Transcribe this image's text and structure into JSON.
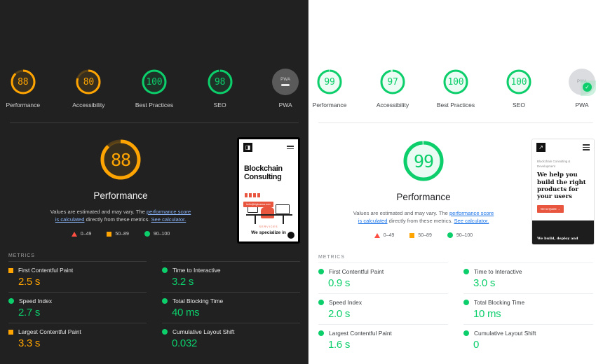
{
  "colors": {
    "pass": "#0cce6b",
    "average": "#ffa400",
    "fail": "#ff4e42",
    "dark_bg": "#212121",
    "light_bg": "#ffffff",
    "link_dark": "#8ab4f8",
    "link_light": "#1a73e8"
  },
  "common": {
    "metrics_header": "METRICS",
    "category_title": "Performance",
    "desc_part1": "Values are estimated and may vary. The ",
    "desc_link1": "performance score is calculated",
    "desc_part2": " directly from these metrics. ",
    "desc_link2": "See calculator.",
    "legend": [
      {
        "shape": "triangle",
        "label": "0–49",
        "color": "#ff4e42"
      },
      {
        "shape": "square",
        "label": "50–89",
        "color": "#ffa400"
      },
      {
        "shape": "circle",
        "label": "90–100",
        "color": "#0cce6b"
      }
    ]
  },
  "left": {
    "theme": "dark",
    "gauges": [
      {
        "label": "Performance",
        "score": 88,
        "color": "#ffa400",
        "type": "score"
      },
      {
        "label": "Accessibility",
        "score": 80,
        "color": "#ffa400",
        "type": "score"
      },
      {
        "label": "Best Practices",
        "score": 100,
        "color": "#0cce6b",
        "type": "score"
      },
      {
        "label": "SEO",
        "score": 98,
        "color": "#0cce6b",
        "type": "score"
      },
      {
        "label": "PWA",
        "badge_text": "PWA",
        "type": "pwa",
        "state": "not-applicable"
      }
    ],
    "summary": {
      "score": 88,
      "color": "#ffa400"
    },
    "metrics": [
      {
        "name": "First Contentful Paint",
        "value": "2.5 s",
        "rating": "average",
        "shape": "square",
        "color": "#ffa400"
      },
      {
        "name": "Time to Interactive",
        "value": "3.2 s",
        "rating": "pass",
        "shape": "circle",
        "color": "#0cce6b"
      },
      {
        "name": "Speed Index",
        "value": "2.7 s",
        "rating": "pass",
        "shape": "circle",
        "color": "#0cce6b"
      },
      {
        "name": "Total Blocking Time",
        "value": "40 ms",
        "rating": "pass",
        "shape": "circle",
        "color": "#0cce6b"
      },
      {
        "name": "Largest Contentful Paint",
        "value": "3.3 s",
        "rating": "average",
        "shape": "square",
        "color": "#ffa400"
      },
      {
        "name": "Cumulative Layout Shift",
        "value": "0.032",
        "rating": "pass",
        "shape": "circle",
        "color": "#0cce6b"
      }
    ],
    "screenshot": {
      "logo_glyph": "◨",
      "heading": "Blockchain Consulting",
      "badge": "hello@bigbrassa.com",
      "services_label": "SERVICES",
      "footer_text": "We specialize in"
    }
  },
  "right": {
    "theme": "light",
    "gauges": [
      {
        "label": "Performance",
        "score": 99,
        "color": "#0cce6b",
        "type": "score"
      },
      {
        "label": "Accessibility",
        "score": 97,
        "color": "#0cce6b",
        "type": "score"
      },
      {
        "label": "Best Practices",
        "score": 100,
        "color": "#0cce6b",
        "type": "score"
      },
      {
        "label": "SEO",
        "score": 100,
        "color": "#0cce6b",
        "type": "score"
      },
      {
        "label": "PWA",
        "badge_text": "PWA",
        "type": "pwa",
        "state": "pass"
      }
    ],
    "summary": {
      "score": 99,
      "color": "#0cce6b"
    },
    "metrics": [
      {
        "name": "First Contentful Paint",
        "value": "0.9 s",
        "rating": "pass",
        "shape": "circle",
        "color": "#0cce6b"
      },
      {
        "name": "Time to Interactive",
        "value": "3.0 s",
        "rating": "pass",
        "shape": "circle",
        "color": "#0cce6b"
      },
      {
        "name": "Speed Index",
        "value": "2.0 s",
        "rating": "pass",
        "shape": "circle",
        "color": "#0cce6b"
      },
      {
        "name": "Total Blocking Time",
        "value": "10 ms",
        "rating": "pass",
        "shape": "circle",
        "color": "#0cce6b"
      },
      {
        "name": "Largest Contentful Paint",
        "value": "1.6 s",
        "rating": "pass",
        "shape": "circle",
        "color": "#0cce6b"
      },
      {
        "name": "Cumulative Layout Shift",
        "value": "0",
        "rating": "pass",
        "shape": "circle",
        "color": "#0cce6b"
      }
    ],
    "screenshot": {
      "logo_glyph": "↗",
      "eyebrow": "Blockchain Consulting & Development",
      "heading": "We help you build the right products for your users",
      "cta": "Get a Quote →",
      "footer_text": "We build, deploy and"
    }
  }
}
